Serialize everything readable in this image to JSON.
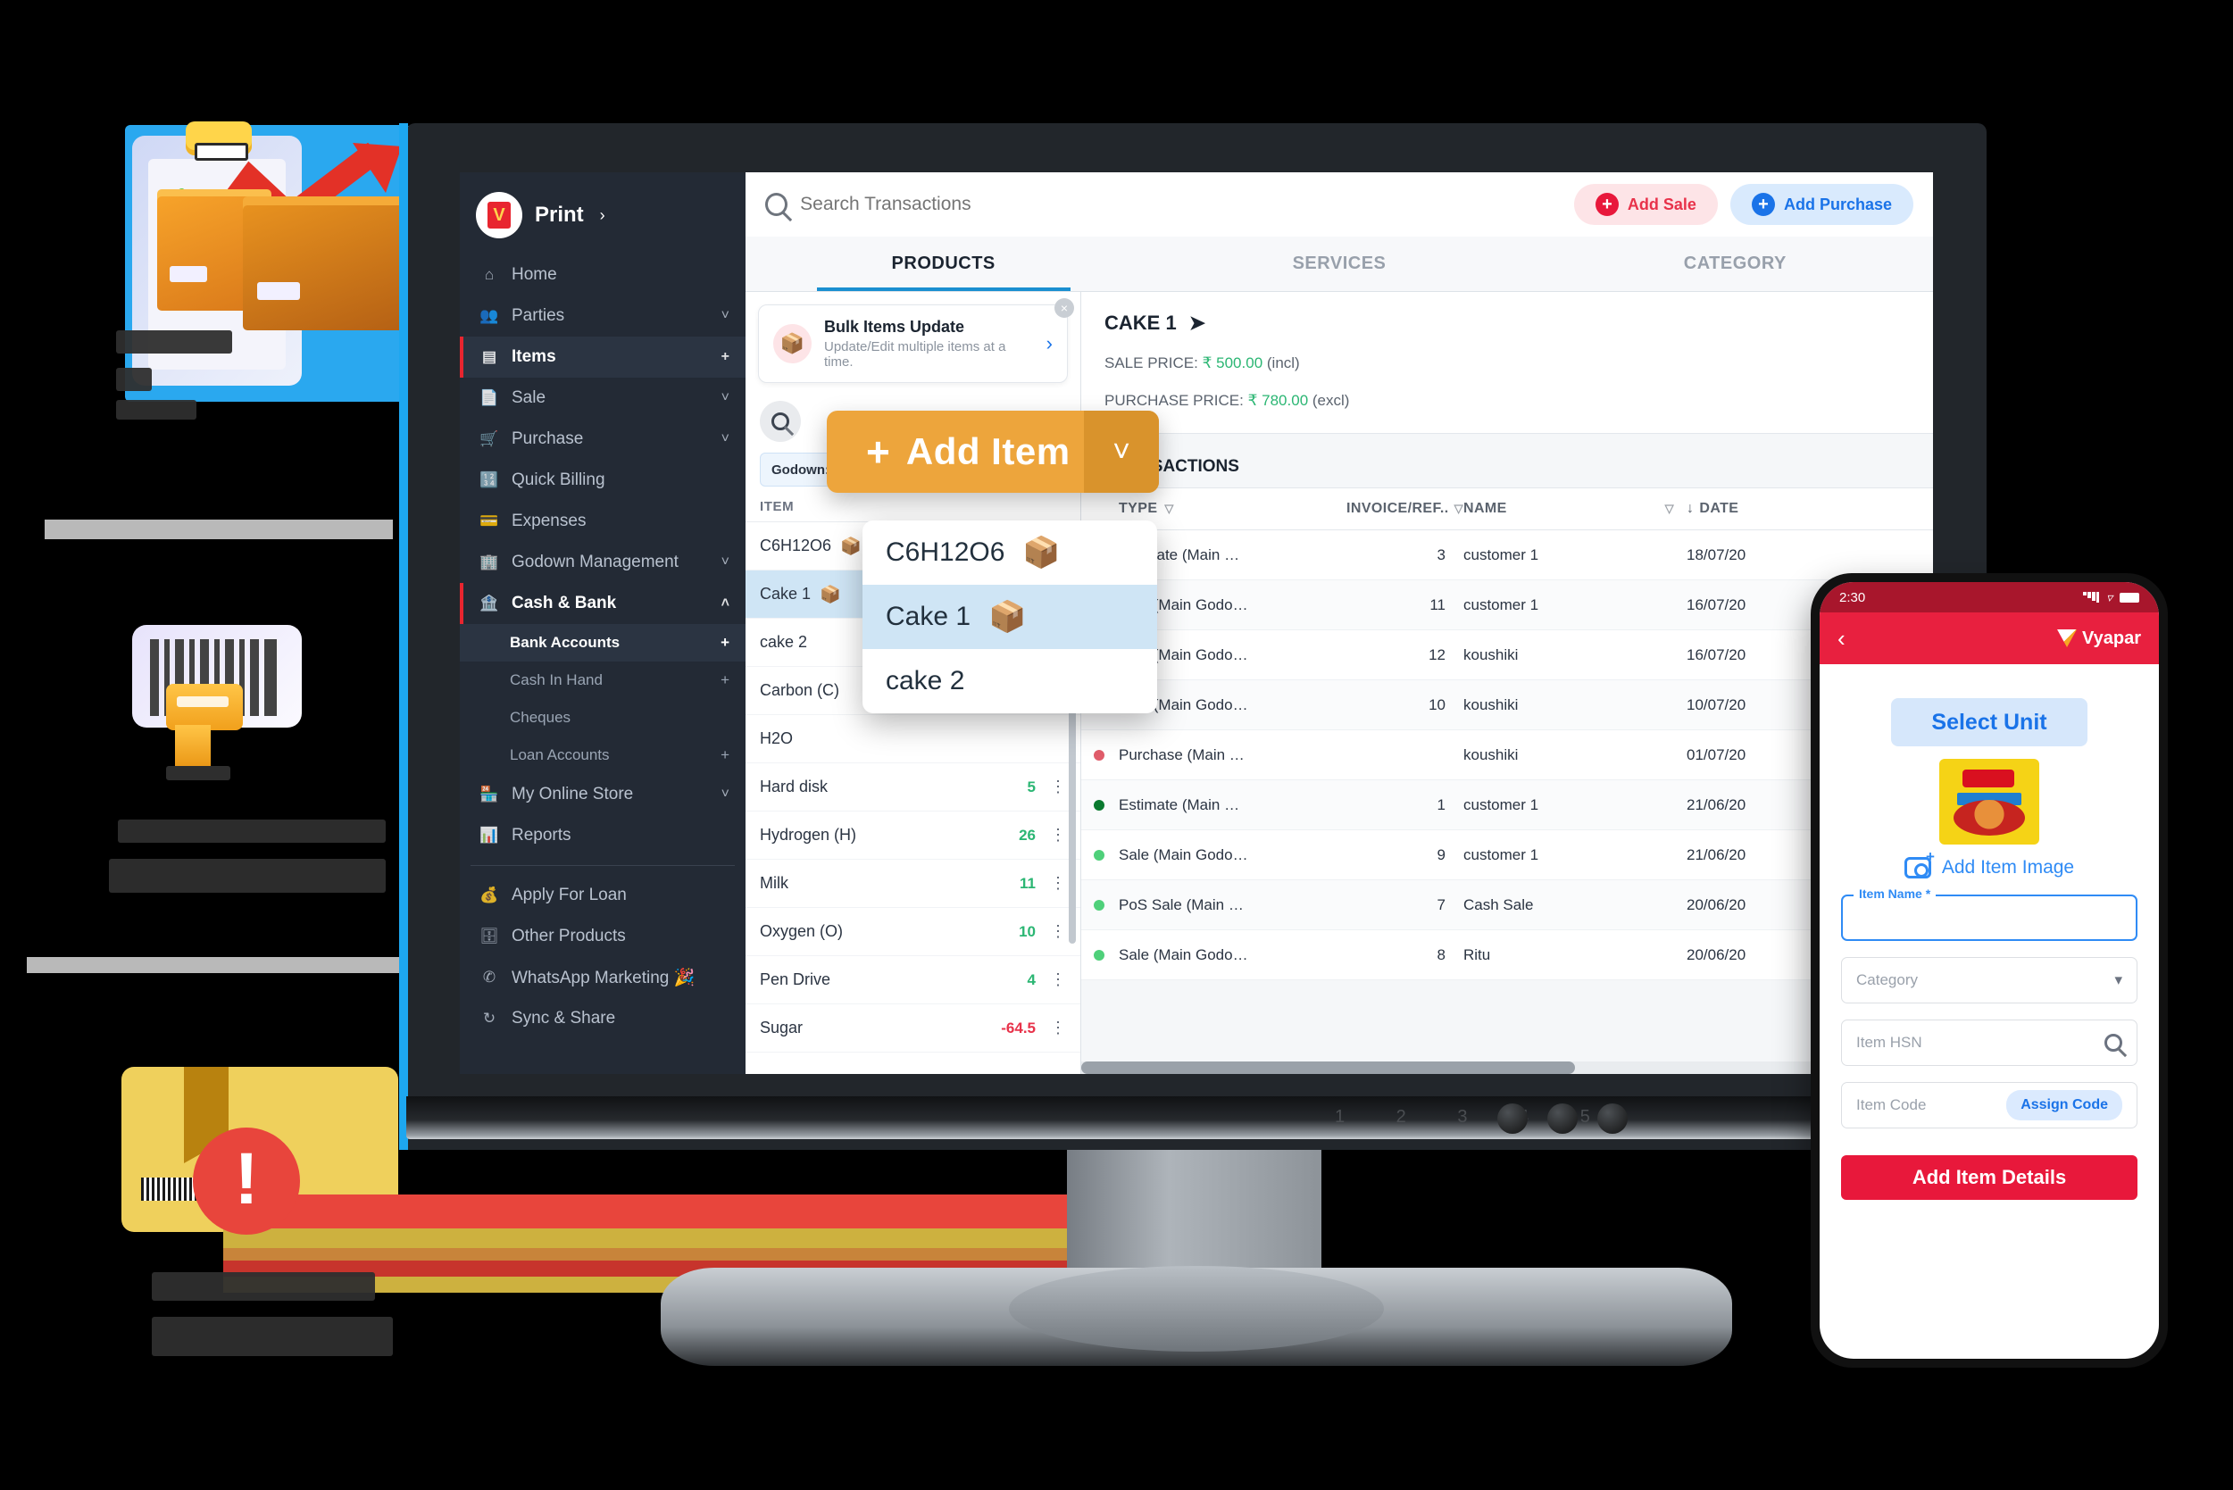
{
  "brand": {
    "logo_text": "V",
    "name": "Print",
    "caret": "›"
  },
  "sidebar": {
    "items": [
      {
        "label": "Home",
        "icon": "home-icon",
        "affix": ""
      },
      {
        "label": "Parties",
        "icon": "people-icon",
        "affix": "˅"
      },
      {
        "label": "Items",
        "icon": "items-icon",
        "affix": "+"
      },
      {
        "label": "Sale",
        "icon": "sale-doc-icon",
        "affix": "˅"
      },
      {
        "label": "Purchase",
        "icon": "cart-icon",
        "affix": "˅"
      },
      {
        "label": "Quick Billing",
        "icon": "calculator-icon",
        "affix": ""
      },
      {
        "label": "Expenses",
        "icon": "wallet-icon",
        "affix": ""
      },
      {
        "label": "Godown Management",
        "icon": "warehouse-icon",
        "affix": "˅"
      },
      {
        "label": "Cash & Bank",
        "icon": "bank-icon",
        "affix": "˄"
      }
    ],
    "sub_items": [
      {
        "label": "Bank Accounts",
        "affix": "+"
      },
      {
        "label": "Cash In Hand",
        "affix": "+"
      },
      {
        "label": "Cheques",
        "affix": ""
      },
      {
        "label": "Loan Accounts",
        "affix": "+"
      }
    ],
    "items_2": [
      {
        "label": "My Online Store",
        "icon": "store-icon",
        "affix": "˅"
      },
      {
        "label": "Reports",
        "icon": "bar-chart-icon",
        "affix": ""
      }
    ],
    "items_3": [
      {
        "label": "Apply For Loan",
        "icon": "money-bag-icon",
        "affix": ""
      },
      {
        "label": "Other Products",
        "icon": "products-icon",
        "affix": ""
      },
      {
        "label": "WhatsApp Marketing 🎉",
        "icon": "whatsapp-icon",
        "affix": ""
      },
      {
        "label": "Sync & Share",
        "icon": "sync-icon",
        "affix": ""
      }
    ]
  },
  "topbar": {
    "search_placeholder": "Search Transactions",
    "add_sale": "Add Sale",
    "add_purchase": "Add Purchase"
  },
  "tabs": [
    {
      "label": "PRODUCTS",
      "active": true
    },
    {
      "label": "SERVICES",
      "active": false
    },
    {
      "label": "CATEGORY",
      "active": false
    }
  ],
  "bulk_card": {
    "title": "Bulk Items Update",
    "subtitle": "Update/Edit multiple items at a time.",
    "arrow": "›",
    "close": "×"
  },
  "add_item_button": {
    "plus": "+",
    "label": "Add Item",
    "caret": "˅"
  },
  "godown_filter": {
    "label": "Godown: All Godowns",
    "caret": "˅"
  },
  "item_list": {
    "header": "ITEM",
    "rows": [
      {
        "name": "C6H12O6",
        "box": true,
        "qty": "",
        "neg": false
      },
      {
        "name": "Cake 1",
        "box": true,
        "qty": "",
        "neg": false,
        "selected": true
      },
      {
        "name": "cake 2",
        "box": false,
        "qty": "",
        "neg": false
      },
      {
        "name": "Carbon (C)",
        "box": false,
        "qty": "",
        "neg": false
      },
      {
        "name": "H2O",
        "box": false,
        "qty": "",
        "neg": false
      },
      {
        "name": "Hard disk",
        "box": false,
        "qty": "5",
        "neg": false
      },
      {
        "name": "Hydrogen (H)",
        "box": false,
        "qty": "26",
        "neg": false
      },
      {
        "name": "Milk",
        "box": false,
        "qty": "11",
        "neg": false
      },
      {
        "name": "Oxygen (O)",
        "box": false,
        "qty": "10",
        "neg": false
      },
      {
        "name": "Pen Drive",
        "box": false,
        "qty": "4",
        "neg": false
      },
      {
        "name": "Sugar",
        "box": false,
        "qty": "-64.5",
        "neg": true
      }
    ]
  },
  "zoom_popup": {
    "rows": [
      {
        "name": "C6H12O6",
        "selected": false
      },
      {
        "name": "Cake 1",
        "selected": true
      },
      {
        "name": "cake 2",
        "selected": false
      }
    ]
  },
  "detail": {
    "title": "CAKE 1",
    "share_icon": "➤",
    "sale_label": "SALE PRICE:",
    "sale_value": "₹ 500.00",
    "sale_suffix": "(incl)",
    "purchase_label": "PURCHASE PRICE:",
    "purchase_value": "₹ 780.00",
    "purchase_suffix": "(excl)"
  },
  "transactions": {
    "title": "TRANSACTIONS",
    "columns": [
      "TYPE",
      "INVOICE/REF..",
      "NAME",
      "DATE"
    ],
    "sort_arrow": "↓",
    "rows": [
      {
        "status": "dark-green",
        "type": "Estimate (Main …",
        "invoice": "3",
        "name": "customer 1",
        "date": "18/07/20"
      },
      {
        "status": "green",
        "type": "Sale (Main Godo…",
        "invoice": "11",
        "name": "customer 1",
        "date": "16/07/20"
      },
      {
        "status": "green",
        "type": "Sale (Main Godo…",
        "invoice": "12",
        "name": "koushiki",
        "date": "16/07/20"
      },
      {
        "status": "green",
        "type": "Sale (Main Godo…",
        "invoice": "10",
        "name": "koushiki",
        "date": "10/07/20"
      },
      {
        "status": "red",
        "type": "Purchase (Main …",
        "invoice": "",
        "name": "koushiki",
        "date": "01/07/20"
      },
      {
        "status": "dark-green",
        "type": "Estimate (Main …",
        "invoice": "1",
        "name": "customer 1",
        "date": "21/06/20"
      },
      {
        "status": "green",
        "type": "Sale (Main Godo…",
        "invoice": "9",
        "name": "customer 1",
        "date": "21/06/20"
      },
      {
        "status": "green",
        "type": "PoS Sale (Main …",
        "invoice": "7",
        "name": "Cash Sale",
        "date": "20/06/20"
      },
      {
        "status": "green",
        "type": "Sale (Main Godo…",
        "invoice": "8",
        "name": "Ritu",
        "date": "20/06/20"
      }
    ]
  },
  "monitor": {
    "chin_numbers": "1 2 3 4 5"
  },
  "phone": {
    "status_time": "2:30",
    "back_icon": "‹",
    "brand": "Vyapar",
    "select_unit": "Select Unit",
    "add_item_image": "Add Item Image",
    "item_name_label": "Item Name *",
    "item_name_value": "",
    "category_placeholder": "Category",
    "category_caret": "▾",
    "item_hsn_placeholder": "Item HSN",
    "item_code_placeholder": "Item Code",
    "assign_code": "Assign Code",
    "cta": "Add Item Details"
  },
  "colors": {
    "accent_orange": "#eda53c",
    "brand_red": "#e8183b",
    "blue": "#1a73e8",
    "green": "#2bb673",
    "sidebar_bg": "#232a35"
  }
}
